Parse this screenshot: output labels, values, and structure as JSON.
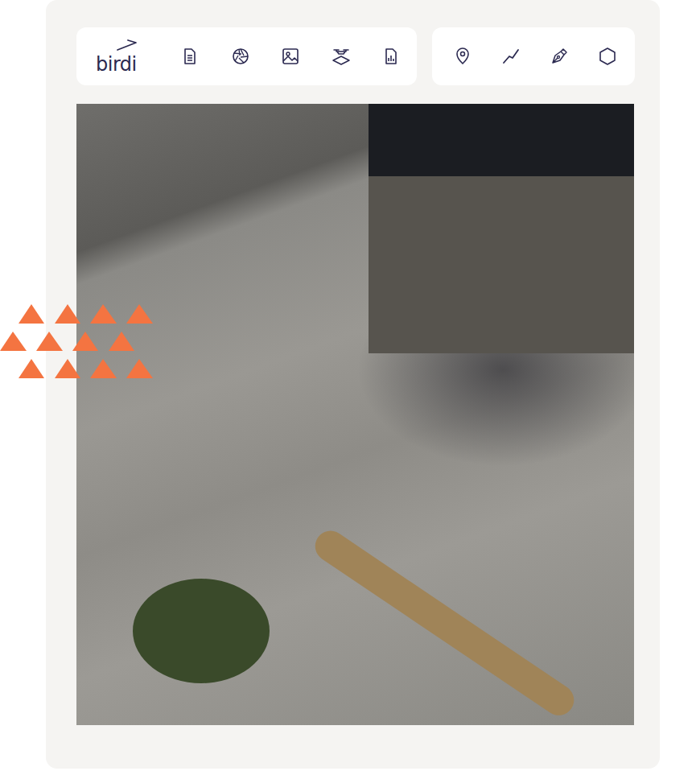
{
  "toolbar": {
    "logo": "birdi"
  }
}
